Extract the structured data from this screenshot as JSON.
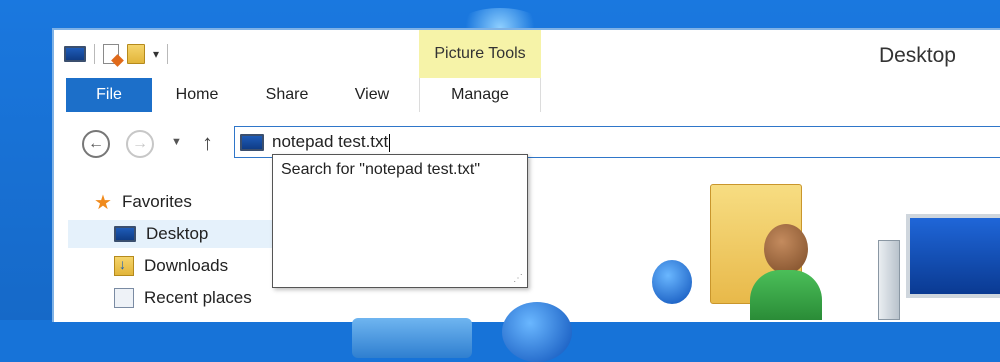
{
  "window": {
    "title": "Desktop",
    "contextual_tab_group": "Picture Tools"
  },
  "ribbon": {
    "tabs": [
      {
        "label": "File"
      },
      {
        "label": "Home"
      },
      {
        "label": "Share"
      },
      {
        "label": "View"
      },
      {
        "label": "Manage"
      }
    ]
  },
  "address_bar": {
    "value": "notepad test.txt"
  },
  "autocomplete": {
    "item": "Search for \"notepad test.txt\""
  },
  "nav_pane": {
    "favorites": "Favorites",
    "items": [
      {
        "label": "Desktop",
        "selected": true
      },
      {
        "label": "Downloads"
      },
      {
        "label": "Recent places"
      }
    ]
  },
  "colors": {
    "file_tab": "#1c6fc9",
    "contextual_highlight": "#f6f3a8",
    "selected_nav": "#e5f1fb",
    "address_border": "#2f76c9"
  }
}
